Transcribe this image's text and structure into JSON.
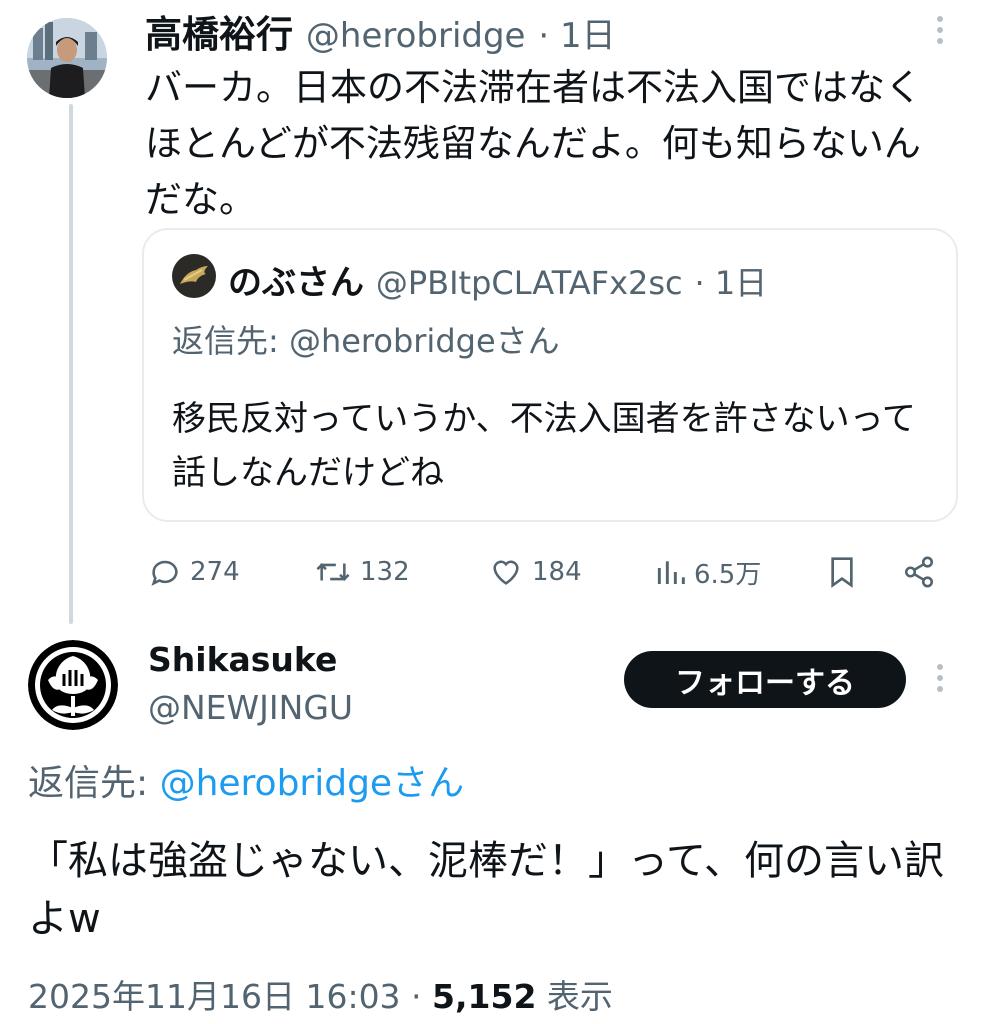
{
  "main_tweet": {
    "display_name": "高橋裕行",
    "handle": "@herobridge",
    "time": "· 1日",
    "text": "バーカ。日本の不法滞在者は不法入国ではなくほとんどが不法残留なんだよ。何も知らないんだな。"
  },
  "quoted_tweet": {
    "display_name": "のぶさん",
    "handle": "@PBItpCLATAFx2sc",
    "time": "· 1日",
    "reply_to": "返信先: @herobridgeさん",
    "text": "移民反対っていうか、不法入国者を許さないって話しなんだけどね"
  },
  "actions": {
    "replies": "274",
    "reposts": "132",
    "likes": "184",
    "views": "6.5万"
  },
  "reply_tweet": {
    "display_name": "Shikasuke",
    "handle": "@NEWJINGU",
    "follow_label": "フォローする",
    "reply_prefix": "返信先: ",
    "reply_mention": "@herobridgeさん",
    "text": "「私は強盗じゃない、泥棒だ！」って、何の言い訳よw",
    "date": "2025年11月16日 16:03 · ",
    "view_count": "5,152",
    "view_label": " 表示"
  },
  "colors": {
    "text": "#0f1419",
    "secondary": "#536471",
    "link": "#1d9bf0",
    "border": "#e6ecf0",
    "follow_bg": "#0f1419"
  },
  "icons": [
    "more-icon",
    "reply-icon",
    "repost-icon",
    "like-icon",
    "views-icon",
    "bookmark-icon",
    "share-icon"
  ]
}
